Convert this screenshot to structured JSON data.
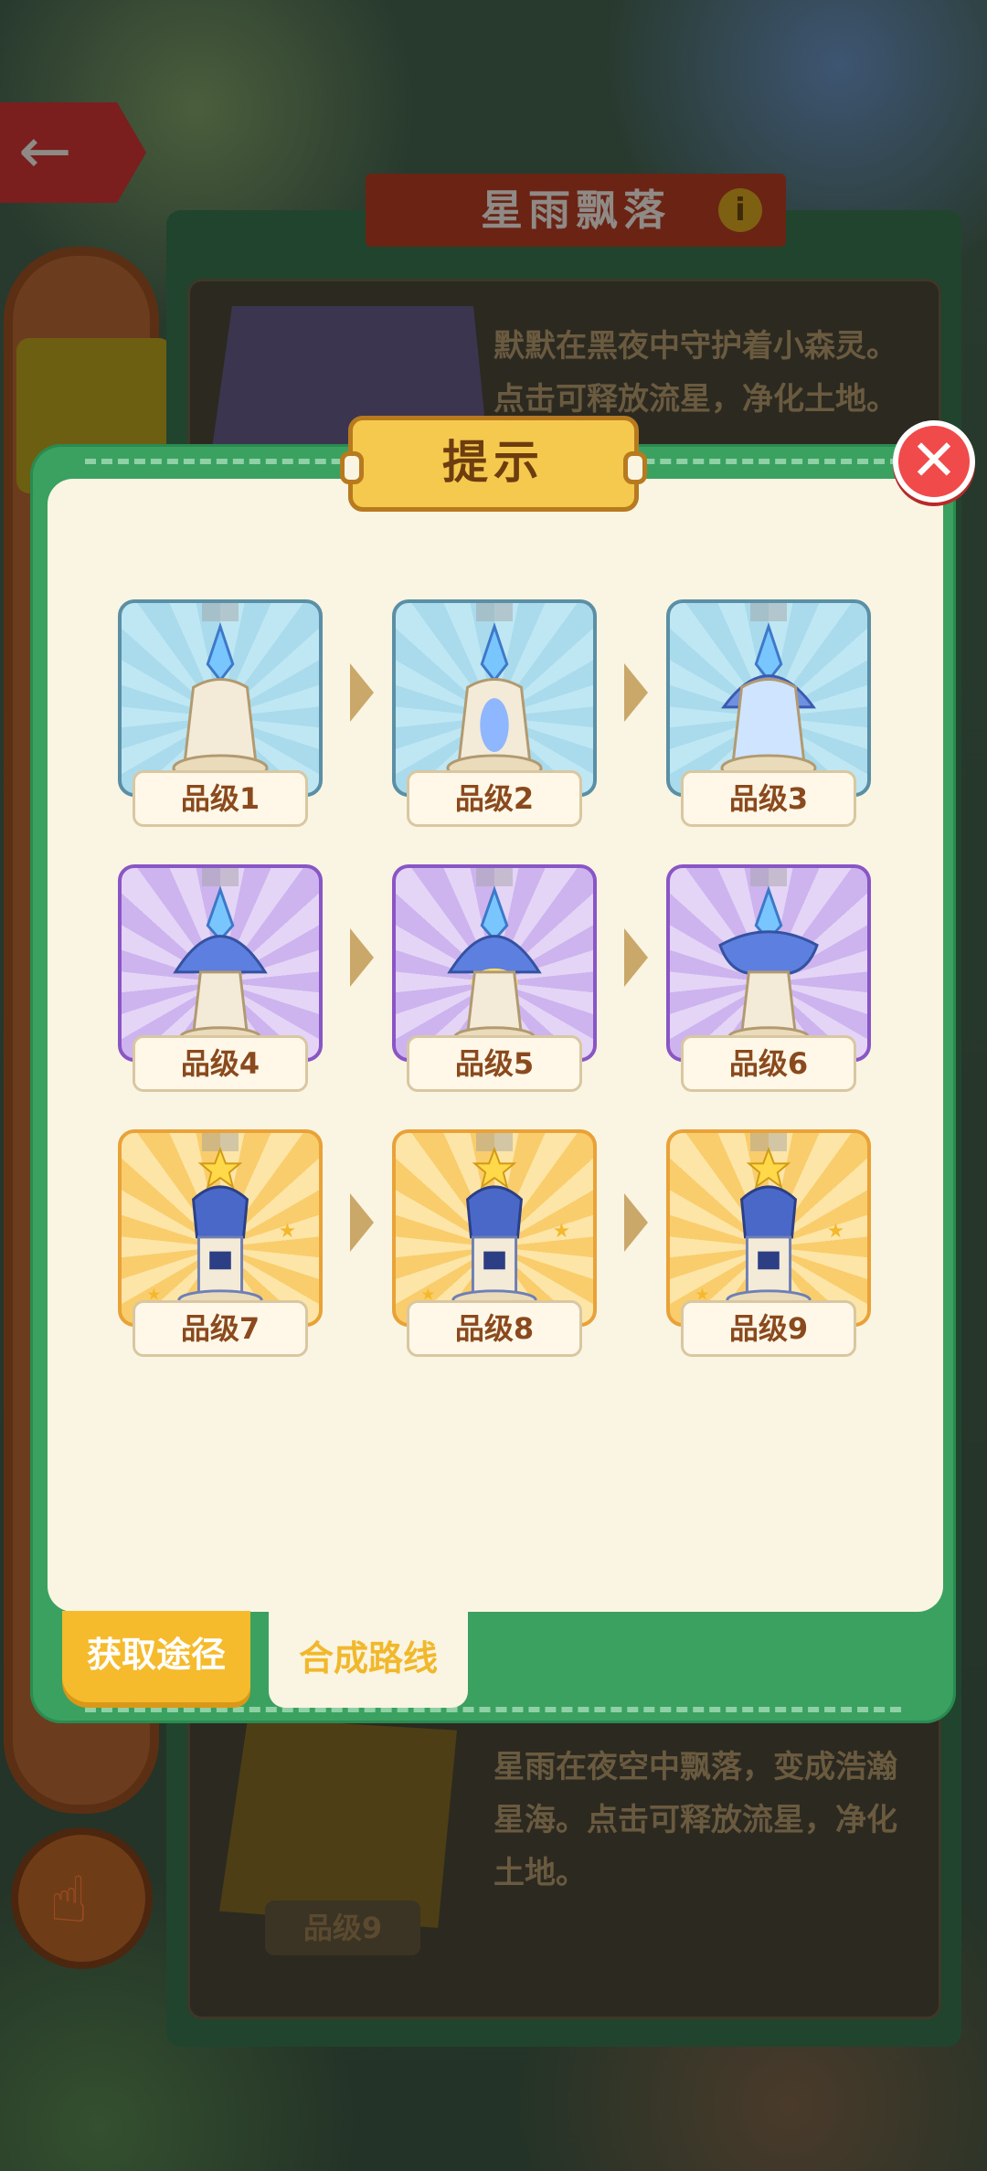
{
  "background": {
    "title": "星雨飘落",
    "info_icon": "i",
    "top_description": "默默在黑夜中守护着小森灵。点击可释放流星，净化土地。",
    "bottom_description": "星雨在夜空中飘落，变成浩瀚星海。点击可释放流星，净化土地。",
    "bottom_grade": "品级9",
    "back_icon": "←",
    "hand_icon": "☝"
  },
  "modal": {
    "title": "提示",
    "close_icon": "✕",
    "tabs": {
      "get": "获取途径",
      "route": "合成路线"
    },
    "active_tab": "route"
  },
  "tiers": [
    {
      "label": "品级1",
      "theme": "blue"
    },
    {
      "label": "品级2",
      "theme": "blue"
    },
    {
      "label": "品级3",
      "theme": "blue"
    },
    {
      "label": "品级4",
      "theme": "purple"
    },
    {
      "label": "品级5",
      "theme": "purple"
    },
    {
      "label": "品级6",
      "theme": "purple"
    },
    {
      "label": "品级7",
      "theme": "gold"
    },
    {
      "label": "品级8",
      "theme": "gold"
    },
    {
      "label": "品级9",
      "theme": "gold"
    }
  ],
  "colors": {
    "modal_green": "#3aa160",
    "panel_cream": "#faf4e3",
    "banner_yellow": "#f5c94e",
    "close_red": "#f04a4a",
    "label_brown": "#8a4a1e"
  }
}
